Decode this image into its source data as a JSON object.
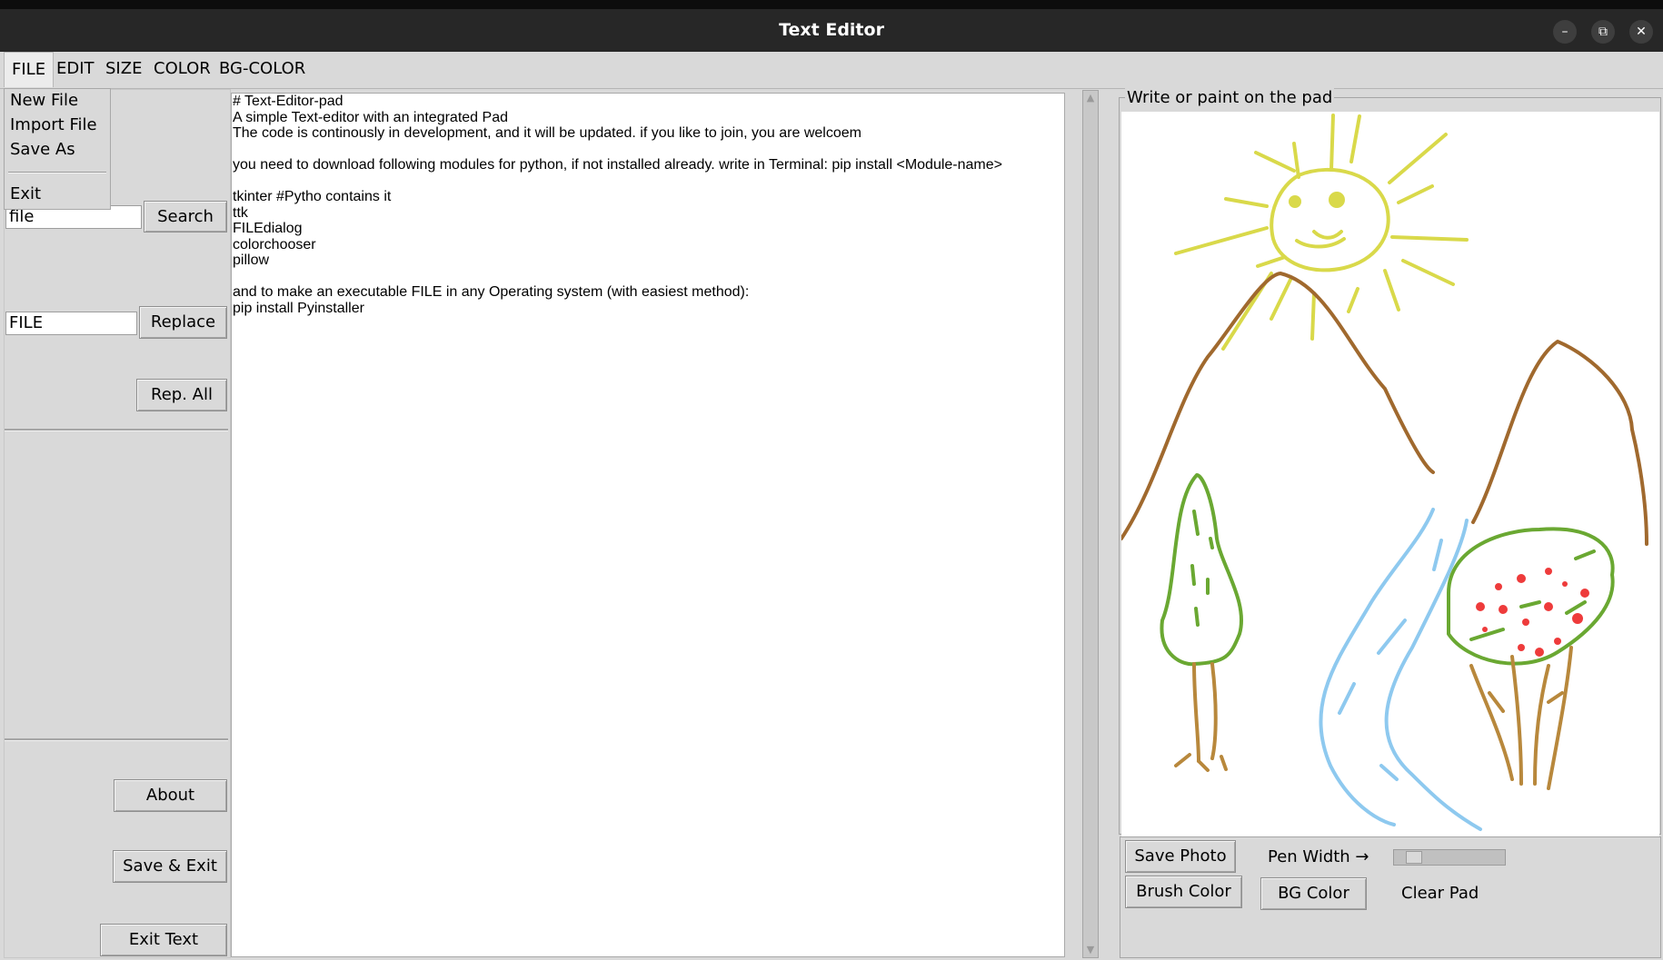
{
  "window": {
    "title": "Text Editor",
    "controls": [
      "–",
      "⧉",
      "✕"
    ]
  },
  "menubar": {
    "items": [
      "FILE",
      "EDIT",
      "SIZE",
      "COLOR",
      "BG-COLOR"
    ]
  },
  "file_menu": {
    "items": [
      "New File",
      "Import File",
      "Save As",
      "Exit"
    ]
  },
  "search": {
    "value": "file",
    "button": "Search"
  },
  "replace": {
    "value": "FILE",
    "button": "Replace",
    "replace_all": "Rep. All"
  },
  "bottom_buttons": {
    "about": "About",
    "save_exit": "Save & Exit",
    "exit_text": "Exit Text"
  },
  "editor": {
    "lines": [
      "# Text-Editor-pad",
      "A simple Text-editor with an integrated Pad",
      "The code is continously in development, and it will be updated. if you like to join, you are welcoem",
      "",
      "you need to download following modules for python, if not installed already. write in Terminal: pip install <Module-name>",
      "",
      "tkinter #Pytho contains it",
      "ttk",
      "FILEdialog",
      "colorchooser",
      "pillow",
      "",
      "and to make an executable FILE in any Operating system (with easiest method):",
      "pip install Pyinstaller"
    ]
  },
  "pad": {
    "label": "Write or paint on the pad",
    "save_photo": "Save Photo",
    "pen_width_label": "Pen Width →",
    "brush_color": "Brush Color",
    "bg_color": "BG Color",
    "clear_pad": "Clear Pad"
  },
  "colors": {
    "sun": "#d9d94a",
    "mountain": "#a0692e",
    "tree_green": "#6aa832",
    "trunk": "#b8883c",
    "river": "#8ec9ef",
    "berries": "#ee3b3b"
  }
}
